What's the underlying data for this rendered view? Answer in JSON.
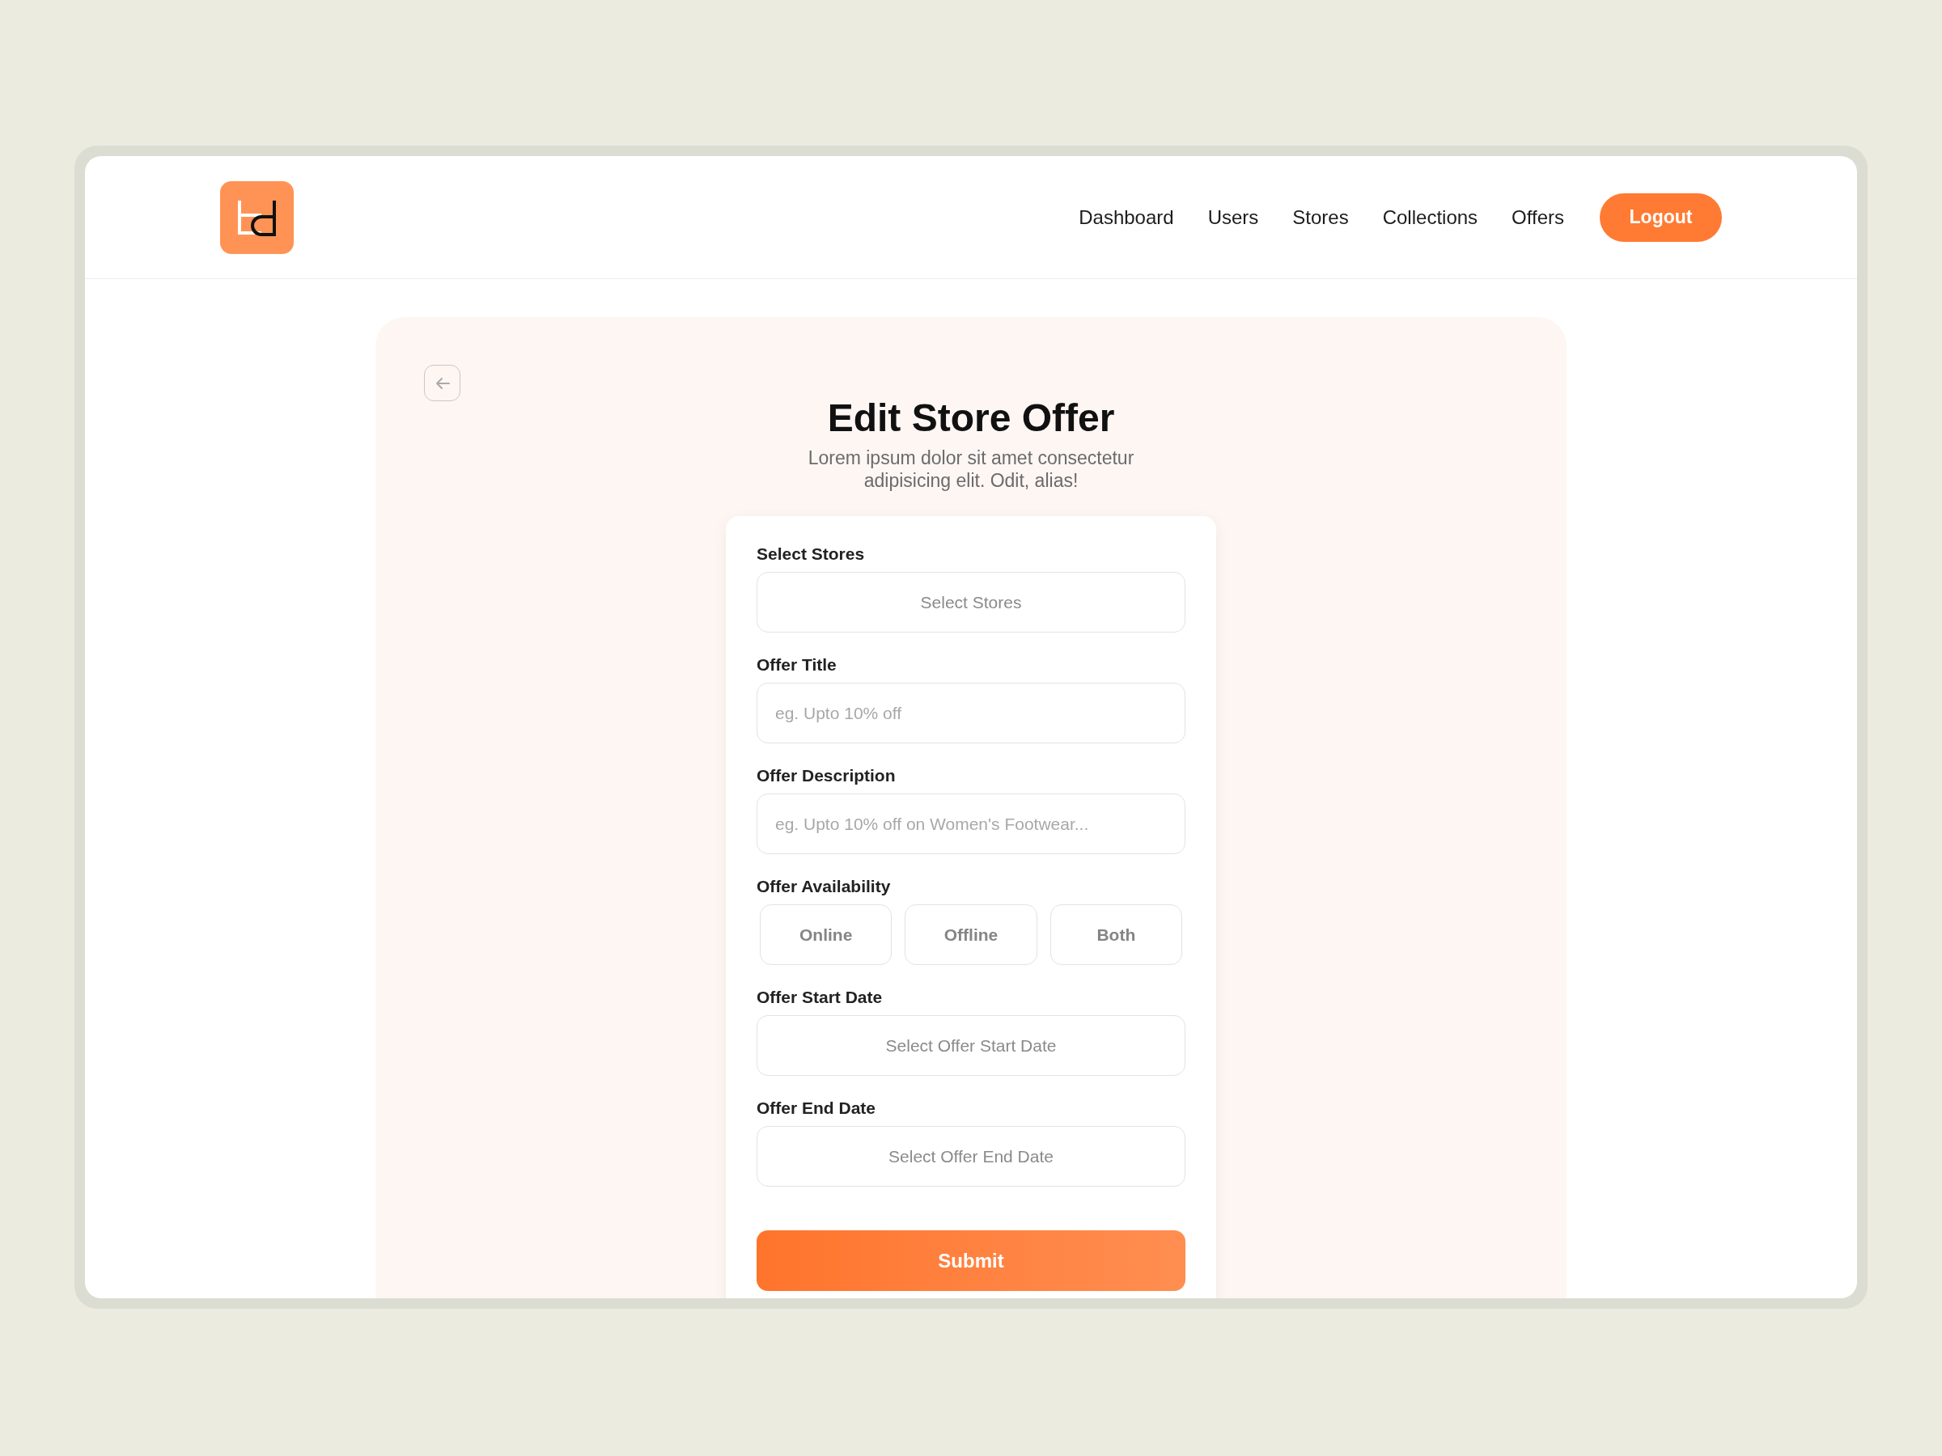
{
  "nav": {
    "items": [
      {
        "label": "Dashboard",
        "selected": false
      },
      {
        "label": "Users",
        "selected": false
      },
      {
        "label": "Stores",
        "selected": false
      },
      {
        "label": "Collections",
        "selected": false
      },
      {
        "label": "Offers",
        "selected": false
      }
    ],
    "logout": "Logout"
  },
  "page": {
    "title": "Edit Store Offer",
    "subtitle": "Lorem ipsum dolor sit amet consectetur adipisicing elit. Odit, alias!"
  },
  "form": {
    "fields": [
      {
        "kind": "select",
        "label": "Select Stores",
        "placeholder": "Select Stores"
      },
      {
        "kind": "text",
        "label": "Offer Title",
        "placeholder": "eg. Upto 10% off"
      },
      {
        "kind": "text",
        "label": "Offer Description",
        "placeholder": "eg. Upto 10% off on Women's Footwear..."
      },
      {
        "kind": "choice",
        "label": "Offer Availability",
        "options": [
          {
            "label": "Online",
            "selected": false
          },
          {
            "label": "Offline",
            "selected": false
          },
          {
            "label": "Both",
            "selected": false
          }
        ]
      },
      {
        "kind": "select",
        "label": "Offer Start Date",
        "placeholder": "Select Offer Start Date"
      },
      {
        "kind": "select",
        "label": "Offer End Date",
        "placeholder": "Select Offer End Date"
      }
    ],
    "submit": "Submit"
  }
}
